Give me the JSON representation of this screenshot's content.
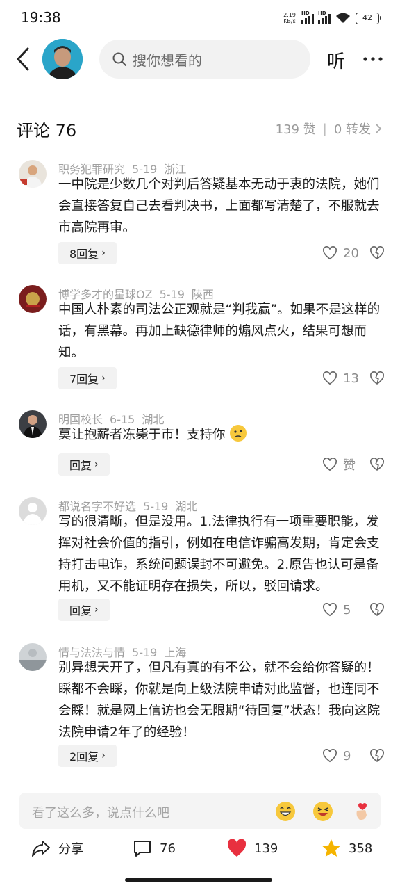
{
  "status_bar": {
    "time": "19:38",
    "net_speed_value": "2.19",
    "net_speed_unit": "KB/s",
    "signal_label": "HD",
    "battery": "42"
  },
  "header": {
    "search_placeholder": "搜你想看的",
    "listen_label": "听"
  },
  "comments_header": {
    "title": "评论 76",
    "likes": "139 赞",
    "separator": "|",
    "reposts": "0 转发"
  },
  "comments": [
    {
      "user": "职务犯罪研究",
      "date": "5-19",
      "location": "浙江",
      "text": "一中院是少数几个对判后答疑基本无动于衷的法院，她们会直接答复自己去看判决书，上面都写清楚了，不服就去市高院再审。",
      "reply_label": "8回复",
      "like_count": "20"
    },
    {
      "user": "博学多才的星球OZ",
      "date": "5-19",
      "location": "陕西",
      "text": "中国人朴素的司法公正观就是“判我赢”。如果不是这样的话，有黑幕。再加上缺德律师的煽风点火，结果可想而知。",
      "reply_label": "7回复",
      "like_count": "13"
    },
    {
      "user": "明国校长",
      "date": "6-15",
      "location": "湖北",
      "text": "莫让抱薪者冻毙于市！支持你",
      "reply_label": "回复",
      "like_count": "赞"
    },
    {
      "user": "都说名字不好选",
      "date": "5-19",
      "location": "湖北",
      "text": "写的很清晰，但是没用。1.法律执行有一项重要职能，发挥对社会价值的指引，例如在电信诈骗高发期，肯定会支持打击电诈，系统问题误封不可避免。2.原告也认可是备用机，又不能证明存在损失，所以，驳回请求。",
      "reply_label": "回复",
      "like_count": "5"
    },
    {
      "user": "情与法法与情",
      "date": "5-19",
      "location": "上海",
      "text": "别异想天开了，但凡有真的有不公，就不会给你答疑的！睬都不会睬，你就是向上级法院申请对此监督，也连同不会睬！就是网上信访也会无限期“待回复”状态！我向这院法院申请2年了的经验！",
      "reply_label": "2回复",
      "like_count": "9"
    }
  ],
  "input": {
    "placeholder": "看了这么多，说点什么吧"
  },
  "actions": {
    "share_label": "分享",
    "comment_count": "76",
    "like_count": "139",
    "favorite_count": "358"
  },
  "colors": {
    "like_red": "#e8303f",
    "star_yellow": "#f5b400",
    "meta_gray": "#a0a0a0"
  }
}
